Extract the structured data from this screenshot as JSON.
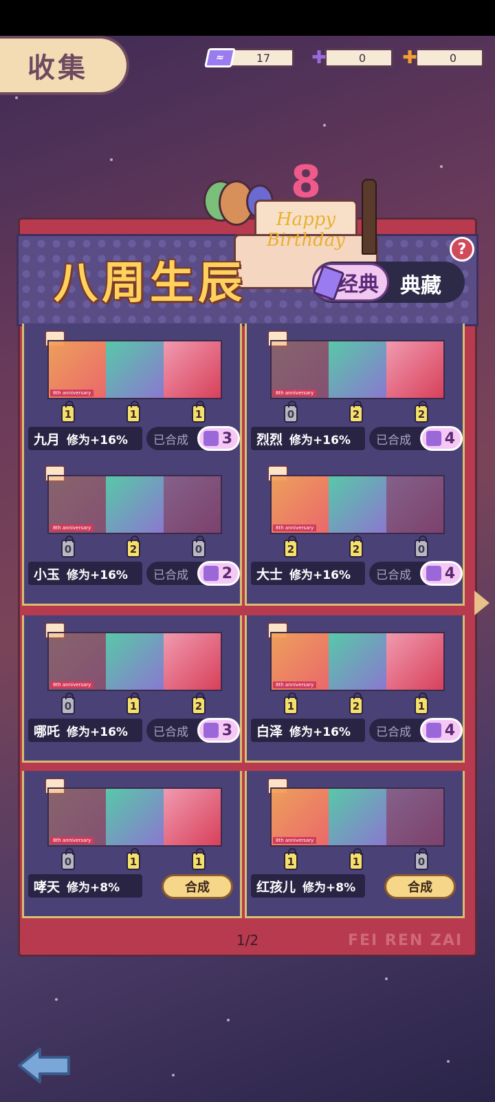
{
  "header": {
    "title": "收集",
    "currencies": [
      {
        "icon": "ticket-icon",
        "value": "17"
      },
      {
        "icon": "purple-puzzle-icon",
        "value": "0"
      },
      {
        "icon": "orange-puzzle-icon",
        "value": "0"
      }
    ]
  },
  "banner": {
    "title": "八周生辰",
    "decoration_text": "Happy Birthday",
    "cake_number": "8",
    "tabs": [
      {
        "label": "经典",
        "active": true
      },
      {
        "label": "典藏",
        "active": false
      }
    ],
    "help": "?"
  },
  "cards": [
    {
      "name": "九月",
      "bonus": "修为+16%",
      "status": "已合成",
      "count": "3",
      "anniv": "8th anniversary",
      "pieces": [
        "1",
        "1",
        "1"
      ],
      "owned": [
        true,
        true,
        true
      ],
      "action": null
    },
    {
      "name": "烈烈",
      "bonus": "修为+16%",
      "status": "已合成",
      "count": "4",
      "anniv": "8th anniversary",
      "pieces": [
        "0",
        "2",
        "2"
      ],
      "owned": [
        false,
        true,
        true
      ],
      "action": null
    },
    {
      "name": "小玉",
      "bonus": "修为+16%",
      "status": "已合成",
      "count": "2",
      "anniv": "8th anniversary",
      "pieces": [
        "0",
        "2",
        "0"
      ],
      "owned": [
        false,
        true,
        false
      ],
      "action": null
    },
    {
      "name": "大士",
      "bonus": "修为+16%",
      "status": "已合成",
      "count": "4",
      "anniv": "8th anniversary",
      "pieces": [
        "2",
        "2",
        "0"
      ],
      "owned": [
        true,
        true,
        false
      ],
      "action": null
    },
    {
      "name": "哪吒",
      "bonus": "修为+16%",
      "status": "已合成",
      "count": "3",
      "anniv": "8th anniversary",
      "pieces": [
        "0",
        "1",
        "2"
      ],
      "owned": [
        false,
        true,
        true
      ],
      "action": null
    },
    {
      "name": "白泽",
      "bonus": "修为+16%",
      "status": "已合成",
      "count": "4",
      "anniv": "8th anniversary",
      "pieces": [
        "1",
        "2",
        "1"
      ],
      "owned": [
        true,
        true,
        true
      ],
      "action": null
    },
    {
      "name": "哮天",
      "bonus": "修为+8%",
      "status": null,
      "count": null,
      "anniv": "8th anniversary",
      "pieces": [
        "0",
        "1",
        "1"
      ],
      "owned": [
        false,
        true,
        true
      ],
      "action": "合成"
    },
    {
      "name": "红孩儿",
      "bonus": "修为+8%",
      "status": null,
      "count": null,
      "anniv": "8th anniversary",
      "pieces": [
        "1",
        "1",
        "0"
      ],
      "owned": [
        true,
        true,
        false
      ],
      "action": "合成"
    }
  ],
  "pager": {
    "text": "1/2",
    "watermark": "FEI REN ZAI"
  },
  "colors": {
    "panel": "#b73a4e",
    "card": "#4a4276",
    "gold": "#ffd25e",
    "lock_on": "#f5e16a",
    "lock_off": "#b8b8c4"
  }
}
